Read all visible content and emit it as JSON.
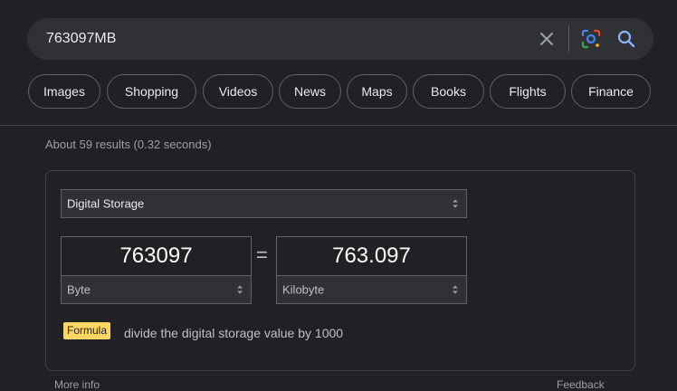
{
  "search": {
    "query": "763097MB",
    "clear_icon": "close-icon",
    "lens_icon": "google-lens-icon",
    "search_icon": "search-icon"
  },
  "chips": [
    "Images",
    "Shopping",
    "Videos",
    "News",
    "Maps",
    "Books",
    "Flights",
    "Finance"
  ],
  "result_stats": "About 59 results (0.32 seconds)",
  "converter": {
    "category": "Digital Storage",
    "from_value": "763097",
    "to_value": "763.097",
    "from_unit": "Byte",
    "to_unit": "Kilobyte",
    "equals": "=",
    "formula_label": "Formula",
    "formula_text": "divide the digital storage value by 1000"
  },
  "footer": {
    "more_info": "More info",
    "feedback": "Feedback"
  },
  "colors": {
    "background": "#202124",
    "surface": "#303134",
    "formula_badge": "#fdd663",
    "search_icon": "#8ab4f8"
  }
}
